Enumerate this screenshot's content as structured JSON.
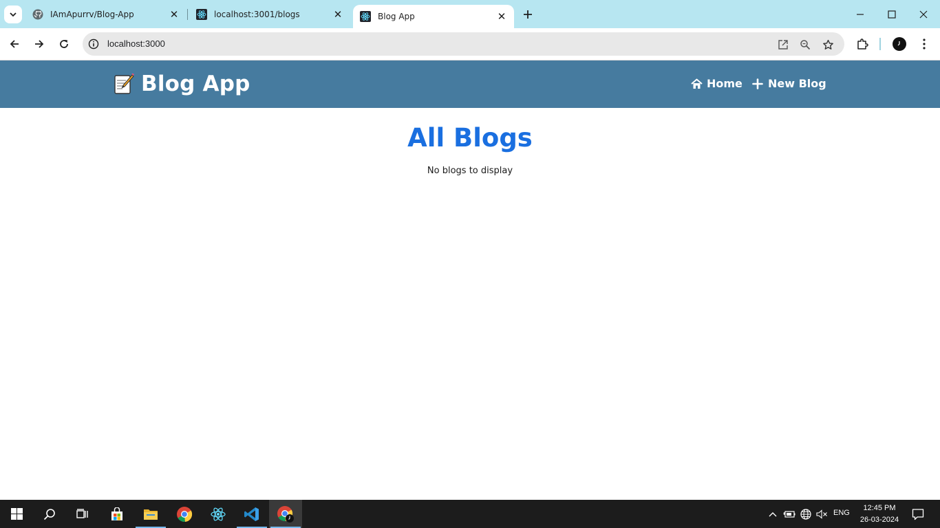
{
  "browser": {
    "tabs": [
      {
        "title": "IAmApurrv/Blog-App",
        "icon": "github-icon",
        "active": false
      },
      {
        "title": "localhost:3001/blogs",
        "icon": "react-icon",
        "active": false
      },
      {
        "title": "Blog App",
        "icon": "react-icon",
        "active": true
      }
    ],
    "address": "localhost:3000"
  },
  "app": {
    "brand": "Blog App",
    "brand_icon": "memo-icon",
    "nav": [
      {
        "label": "Home",
        "icon": "home-icon"
      },
      {
        "label": "New Blog",
        "icon": "plus-icon"
      }
    ],
    "colors": {
      "navbar": "#467b9f",
      "title": "#1a6fe0"
    }
  },
  "main": {
    "title": "All Blogs",
    "empty_message": "No blogs to display"
  },
  "taskbar": {
    "apps": [
      "start-icon",
      "search-icon",
      "task-view-icon",
      "store-icon",
      "file-explorer-icon",
      "chrome-icon",
      "react-app-icon",
      "vscode-icon",
      "chrome-profile-icon"
    ],
    "language": "ENG",
    "time": "12:45 PM",
    "date": "26-03-2024"
  }
}
